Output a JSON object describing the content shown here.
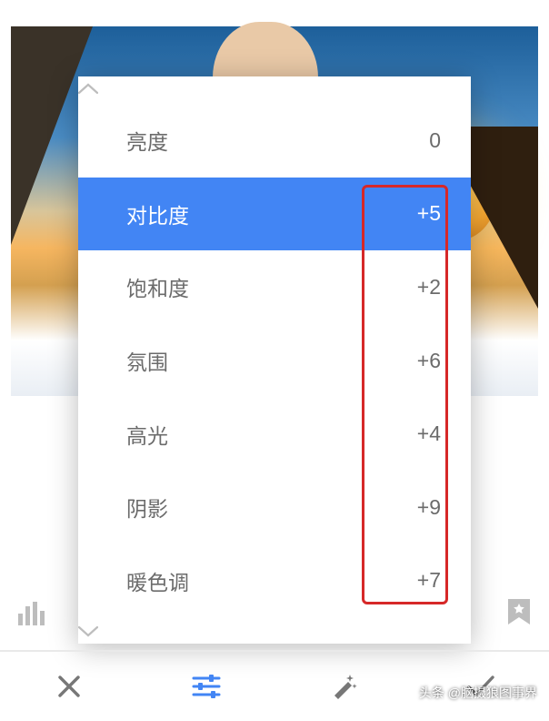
{
  "sliders": [
    {
      "label": "亮度",
      "value": "0",
      "selected": false
    },
    {
      "label": "对比度",
      "value": "+5",
      "selected": true
    },
    {
      "label": "饱和度",
      "value": "+2",
      "selected": false
    },
    {
      "label": "氛围",
      "value": "+6",
      "selected": false
    },
    {
      "label": "高光",
      "value": "+4",
      "selected": false
    },
    {
      "label": "阴影",
      "value": "+9",
      "selected": false
    },
    {
      "label": "暖色调",
      "value": "+7",
      "selected": false
    }
  ],
  "watermark": "头条 @脑摄狼图事界",
  "colors": {
    "accent": "#4285f4",
    "highlight_box": "#d62828"
  }
}
